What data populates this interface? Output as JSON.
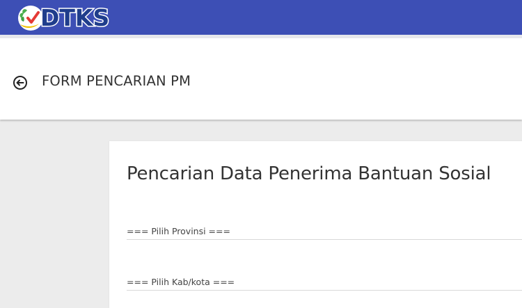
{
  "app": {
    "logo_text": "DTKS",
    "logo_icon": "dtks-emblem-icon"
  },
  "header": {
    "back_icon": "arrow-left-circle-icon",
    "title": "FORM PENCARIAN PM"
  },
  "form": {
    "title": "Pencarian Data Penerima Bantuan Sosial",
    "provinsi_select": {
      "selected": "=== Pilih Provinsi ==="
    },
    "kabkota_select": {
      "selected": "=== Pilih Kab/kota ==="
    }
  },
  "colors": {
    "topbar": "#3d4fb5",
    "logo_text": "#1f3d8c",
    "logo_green": "#4caf50",
    "logo_yellow": "#f2c200",
    "logo_red": "#e53935",
    "background": "#ececec"
  }
}
